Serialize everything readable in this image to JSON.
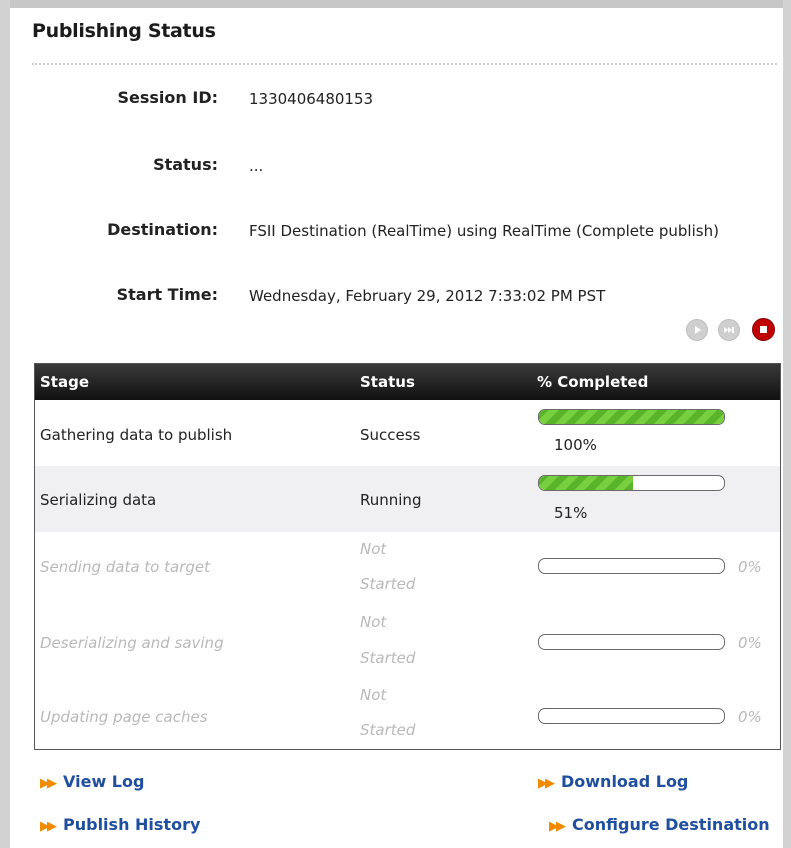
{
  "panel": {
    "title": "Publishing Status"
  },
  "fields": {
    "session_id": {
      "label": "Session ID:",
      "value": "1330406480153"
    },
    "status": {
      "label": "Status:",
      "value": "..."
    },
    "destination": {
      "label": "Destination:",
      "value": "FSII Destination (RealTime) using RealTime (Complete publish)"
    },
    "start_time": {
      "label": "Start Time:",
      "value": "Wednesday, February 29, 2012 7:33:02 PM PST"
    }
  },
  "controls": {
    "play": {
      "icon": "play-icon",
      "enabled": false
    },
    "skip": {
      "icon": "skip-icon",
      "enabled": false
    },
    "stop": {
      "icon": "stop-icon",
      "enabled": true,
      "color": "#c00000"
    }
  },
  "table": {
    "headers": {
      "stage": "Stage",
      "status": "Status",
      "completed": "% Completed"
    },
    "rows": [
      {
        "stage": "Gathering data to publish",
        "status": "Success",
        "percent": 100,
        "percent_label": "100%"
      },
      {
        "stage": "Serializing data",
        "status": "Running",
        "percent": 51,
        "percent_label": "51%"
      },
      {
        "stage": "Sending data to target",
        "status_line1": "Not",
        "status_line2": "Started",
        "percent": 0,
        "percent_label": "0%"
      },
      {
        "stage": "Deserializing and saving",
        "status_line1": "Not",
        "status_line2": "Started",
        "percent": 0,
        "percent_label": "0%"
      },
      {
        "stage": "Updating page caches",
        "status_line1": "Not",
        "status_line2": "Started",
        "percent": 0,
        "percent_label": "0%"
      }
    ]
  },
  "links": {
    "view_log": "View Log",
    "download_log": "Download Log",
    "publish_history": "Publish History",
    "configure_destination": "Configure Destination"
  },
  "colors": {
    "link": "#1f4f9e",
    "arrow": "#f28a00",
    "progress": "#59b42a",
    "header_bg": "#1a1a1a"
  }
}
